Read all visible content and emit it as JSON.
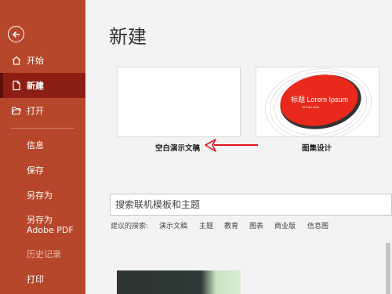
{
  "sidebar": {
    "items": [
      {
        "label": "开始",
        "icon": "home-icon"
      },
      {
        "label": "新建",
        "icon": "new-document-icon",
        "active": true
      },
      {
        "label": "打开",
        "icon": "folder-open-icon"
      },
      {
        "label": "信息"
      },
      {
        "label": "保存"
      },
      {
        "label": "另存为"
      },
      {
        "label": "另存为 Adobe PDF"
      },
      {
        "label": "历史记录",
        "disabled": true
      },
      {
        "label": "打印"
      }
    ]
  },
  "main": {
    "title": "新建",
    "templates": [
      {
        "label": "空白演示文稿"
      },
      {
        "label": "图集设计",
        "preview_title": "标题 Lorem Ipsum",
        "preview_subtitle": "Sit Dolor Amet"
      }
    ],
    "search": {
      "placeholder": "搜索联机模板和主题"
    },
    "suggestions": {
      "lead": "建议的搜索:",
      "items": [
        "演示文稿",
        "主题",
        "教育",
        "图表",
        "商业版",
        "信息图"
      ]
    }
  },
  "colors": {
    "accent": "#b7472a",
    "active": "#8c1e14",
    "preview_red": "#e8291b",
    "arrow": "#e0141e"
  }
}
